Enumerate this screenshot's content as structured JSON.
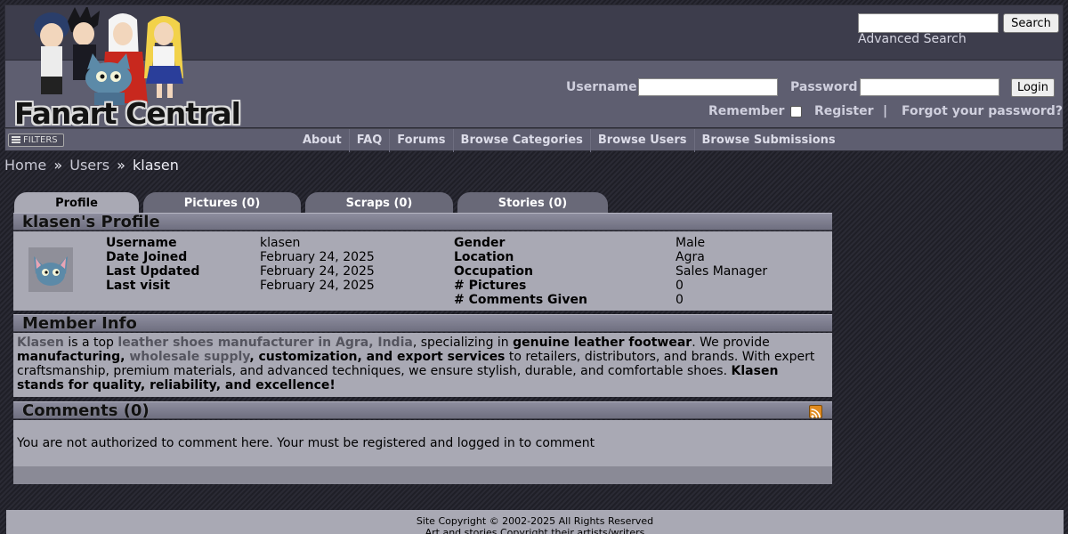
{
  "header": {
    "logo_text": "Fanart Central",
    "search_button": "Search",
    "advanced_search": "Advanced Search",
    "username_label": "Username",
    "password_label": "Password",
    "login_button": "Login",
    "remember_label": "Remember",
    "register_link": "Register",
    "separator": "|",
    "forgot_link": "Forgot your password?"
  },
  "navbar": {
    "filters_label": "FILTERS",
    "items": [
      "About",
      "FAQ",
      "Forums",
      "Browse Categories",
      "Browse Users",
      "Browse Submissions"
    ]
  },
  "breadcrumb": {
    "items": [
      "Home",
      "Users"
    ],
    "separator": "»",
    "current": "klasen"
  },
  "tabs": [
    {
      "label": "Profile",
      "active": true
    },
    {
      "label": "Pictures (0)",
      "active": false
    },
    {
      "label": "Scraps (0)",
      "active": false
    },
    {
      "label": "Stories (0)",
      "active": false
    }
  ],
  "profile": {
    "title": "klasen's Profile",
    "left": [
      {
        "label": "Username",
        "value": "klasen"
      },
      {
        "label": "Date Joined",
        "value": "February 24, 2025"
      },
      {
        "label": "Last Updated",
        "value": "February 24, 2025"
      },
      {
        "label": "Last visit",
        "value": "February 24, 2025"
      }
    ],
    "right": [
      {
        "label": "Gender",
        "value": "Male"
      },
      {
        "label": "Location",
        "value": "Agra"
      },
      {
        "label": "Occupation",
        "value": "Sales Manager"
      },
      {
        "label": "# Pictures",
        "value": "0"
      },
      {
        "label": "# Comments Given",
        "value": "0"
      }
    ]
  },
  "member_info": {
    "title": "Member Info",
    "segments": [
      {
        "text": "Klasen",
        "style": "link"
      },
      {
        "text": " is a top ",
        "style": "plain"
      },
      {
        "text": "leather shoes manufacturer in Agra, India",
        "style": "link"
      },
      {
        "text": ", specializing in ",
        "style": "plain"
      },
      {
        "text": "genuine leather footwear",
        "style": "bold"
      },
      {
        "text": ". We provide ",
        "style": "plain"
      },
      {
        "text": "manufacturing, ",
        "style": "bold"
      },
      {
        "text": "wholesale supply",
        "style": "link"
      },
      {
        "text": ", customization, and export services",
        "style": "bold"
      },
      {
        "text": " to retailers, distributors, and brands. With expert craftsmanship, premium materials, and advanced techniques, we ensure stylish, durable, and comfortable shoes. ",
        "style": "plain"
      },
      {
        "text": "Klasen stands for quality, reliability, and excellence!",
        "style": "bold"
      }
    ]
  },
  "comments": {
    "title": "Comments (0)",
    "message": "You are not authorized to comment here. Your must be registered and logged in to comment"
  },
  "footer": {
    "line1": "Site Copyright © 2002-2025 All Rights Reserved",
    "line2": "Art and stories Copyright their artists/writers"
  },
  "colors": {
    "background": "#23232c",
    "header": "#5e5e70",
    "panel": "#a9a9b4",
    "panel_header": "#7c7c8c",
    "tab_inactive": "#696978"
  }
}
